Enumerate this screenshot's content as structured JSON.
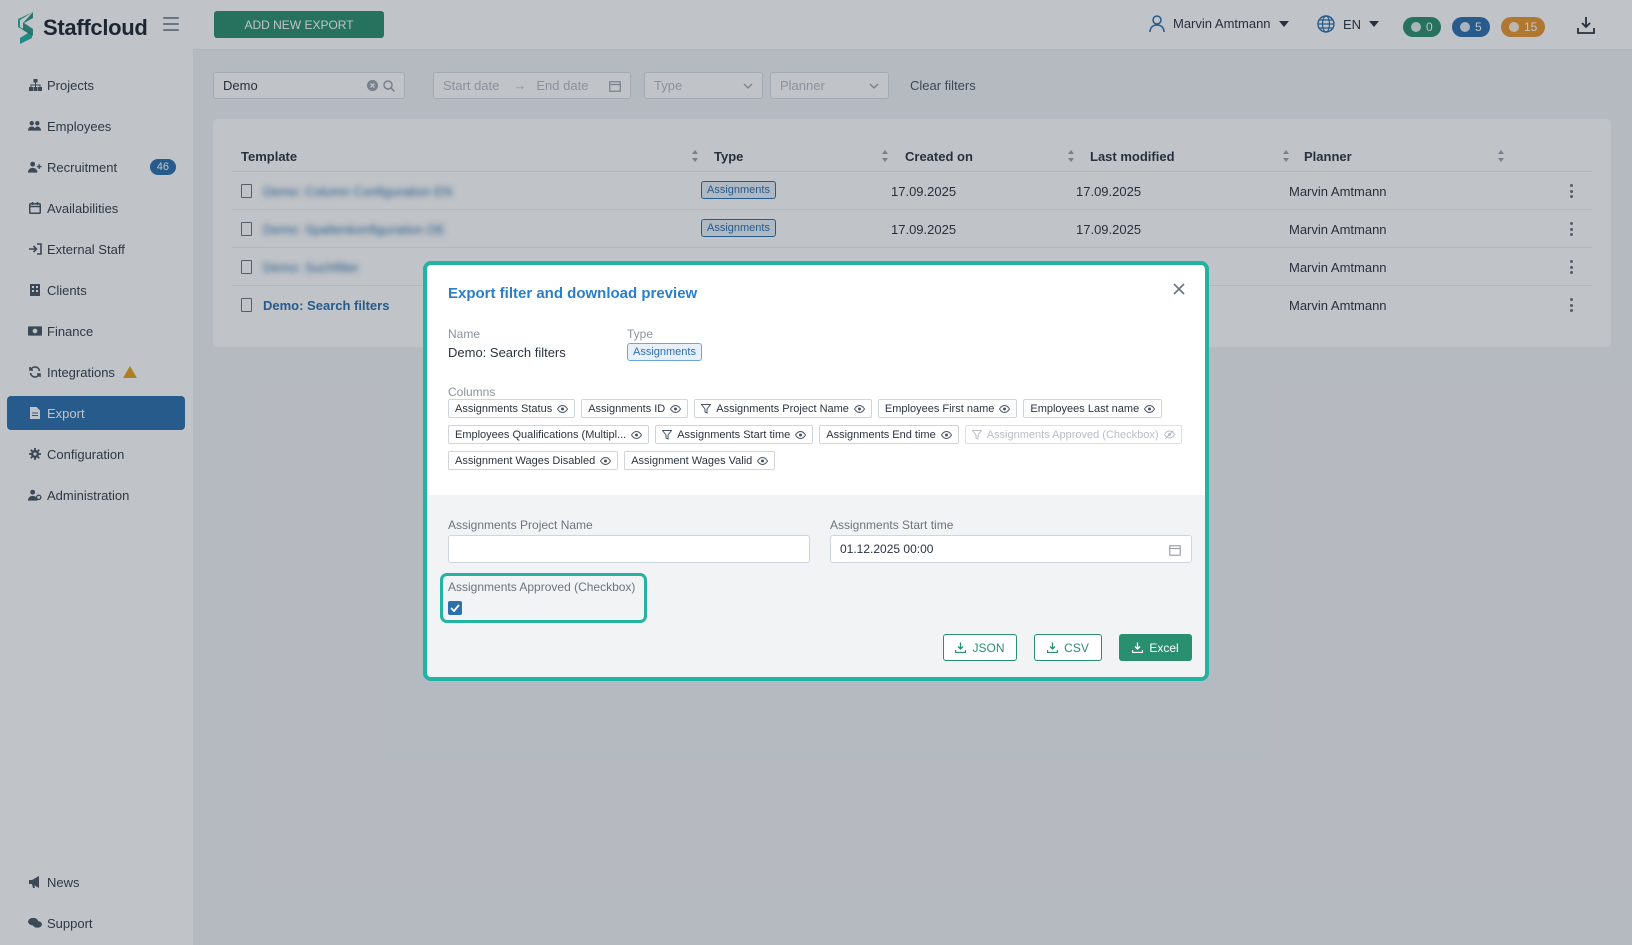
{
  "app": {
    "name": "Staffcloud"
  },
  "sidebar": {
    "items": [
      {
        "label": "Projects",
        "icon": "sitemap-icon"
      },
      {
        "label": "Employees",
        "icon": "users-icon"
      },
      {
        "label": "Recruitment",
        "icon": "user-plus-icon",
        "badge": "46"
      },
      {
        "label": "Availabilities",
        "icon": "calendar-icon"
      },
      {
        "label": "External Staff",
        "icon": "sign-in-icon"
      },
      {
        "label": "Clients",
        "icon": "building-icon"
      },
      {
        "label": "Finance",
        "icon": "money-icon"
      },
      {
        "label": "Integrations",
        "icon": "sync-icon",
        "warning": true
      },
      {
        "label": "Export",
        "icon": "file-icon",
        "active": true
      },
      {
        "label": "Configuration",
        "icon": "gear-icon"
      },
      {
        "label": "Administration",
        "icon": "user-cog-icon"
      }
    ],
    "bottom": [
      {
        "label": "News",
        "icon": "megaphone-icon"
      },
      {
        "label": "Support",
        "icon": "chat-icon"
      }
    ]
  },
  "topbar": {
    "add_button": "ADD NEW EXPORT",
    "user_name": "Marvin Amtmann",
    "language": "EN",
    "counters": [
      {
        "value": "0",
        "color": "#2a8f6e"
      },
      {
        "value": "5",
        "color": "#2c6fae"
      },
      {
        "value": "15",
        "color": "#e8962e"
      }
    ]
  },
  "filters": {
    "search_value": "Demo",
    "start_date_placeholder": "Start date",
    "end_date_placeholder": "End date",
    "type_placeholder": "Type",
    "planner_placeholder": "Planner",
    "clear_label": "Clear filters"
  },
  "table": {
    "headers": [
      "Template",
      "Type",
      "Created on",
      "Last modified",
      "Planner"
    ],
    "rows": [
      {
        "template": "Demo: Column Configuration EN",
        "type": "Assignments",
        "created": "17.09.2025",
        "modified": "17.09.2025",
        "planner": "Marvin Amtmann"
      },
      {
        "template": "Demo: Spaltenkonfiguration DE",
        "type": "Assignments",
        "created": "17.09.2025",
        "modified": "17.09.2025",
        "planner": "Marvin Amtmann"
      },
      {
        "template": "Demo: Suchfilter",
        "type": "",
        "created": "",
        "modified": "",
        "planner": "Marvin Amtmann"
      },
      {
        "template": "Demo: Search filters",
        "type": "",
        "created": "",
        "modified": "",
        "planner": "Marvin Amtmann"
      }
    ]
  },
  "modal": {
    "title": "Export filter and download preview",
    "name_label": "Name",
    "name_value": "Demo: Search filters",
    "type_label": "Type",
    "type_value": "Assignments",
    "columns_label": "Columns",
    "columns": [
      {
        "label": "Assignments Status",
        "filter": false,
        "visible": true
      },
      {
        "label": "Assignments ID",
        "filter": false,
        "visible": true
      },
      {
        "label": "Assignments Project Name",
        "filter": true,
        "visible": true
      },
      {
        "label": "Employees First name",
        "filter": false,
        "visible": true
      },
      {
        "label": "Employees Last name",
        "filter": false,
        "visible": true
      },
      {
        "label": "Employees Qualifications (Multipl...",
        "filter": false,
        "visible": true
      },
      {
        "label": "Assignments Start time",
        "filter": true,
        "visible": true
      },
      {
        "label": "Assignments End time",
        "filter": false,
        "visible": true
      },
      {
        "label": "Assignments Approved (Checkbox)",
        "filter": true,
        "visible": false
      },
      {
        "label": "Assignment Wages Disabled",
        "filter": false,
        "visible": true
      },
      {
        "label": "Assignment Wages Valid",
        "filter": false,
        "visible": true
      }
    ],
    "project_name_label": "Assignments Project Name",
    "project_name_value": "",
    "start_time_label": "Assignments Start time",
    "start_time_value": "01.12.2025 00:00",
    "approved_label": "Assignments Approved (Checkbox)",
    "approved_checked": true,
    "buttons": {
      "json": "JSON",
      "csv": "CSV",
      "excel": "Excel"
    }
  },
  "colors": {
    "accent": "#2a8f6e",
    "primary": "#2c6fae",
    "highlight": "#23b3a1"
  }
}
